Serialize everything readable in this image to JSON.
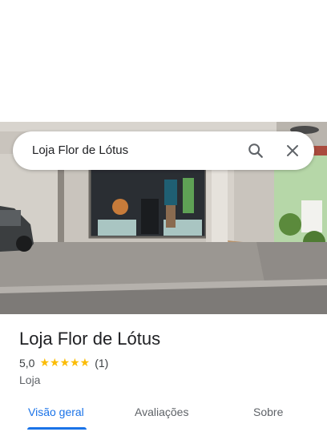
{
  "search": {
    "query": "Loja Flor de Lótus",
    "search_icon": "search-icon",
    "close_icon": "close-icon"
  },
  "place": {
    "name": "Loja Flor de Lótus",
    "rating": "5,0",
    "stars": "★★★★★",
    "review_count": "(1)",
    "category": "Loja"
  },
  "tabs": [
    {
      "label": "Visão geral",
      "active": true
    },
    {
      "label": "Avaliações",
      "active": false
    },
    {
      "label": "Sobre",
      "active": false
    }
  ],
  "colors": {
    "accent": "#1a73e8",
    "star": "#fbbc04",
    "title": "#202124",
    "secondary": "#5f6368"
  }
}
